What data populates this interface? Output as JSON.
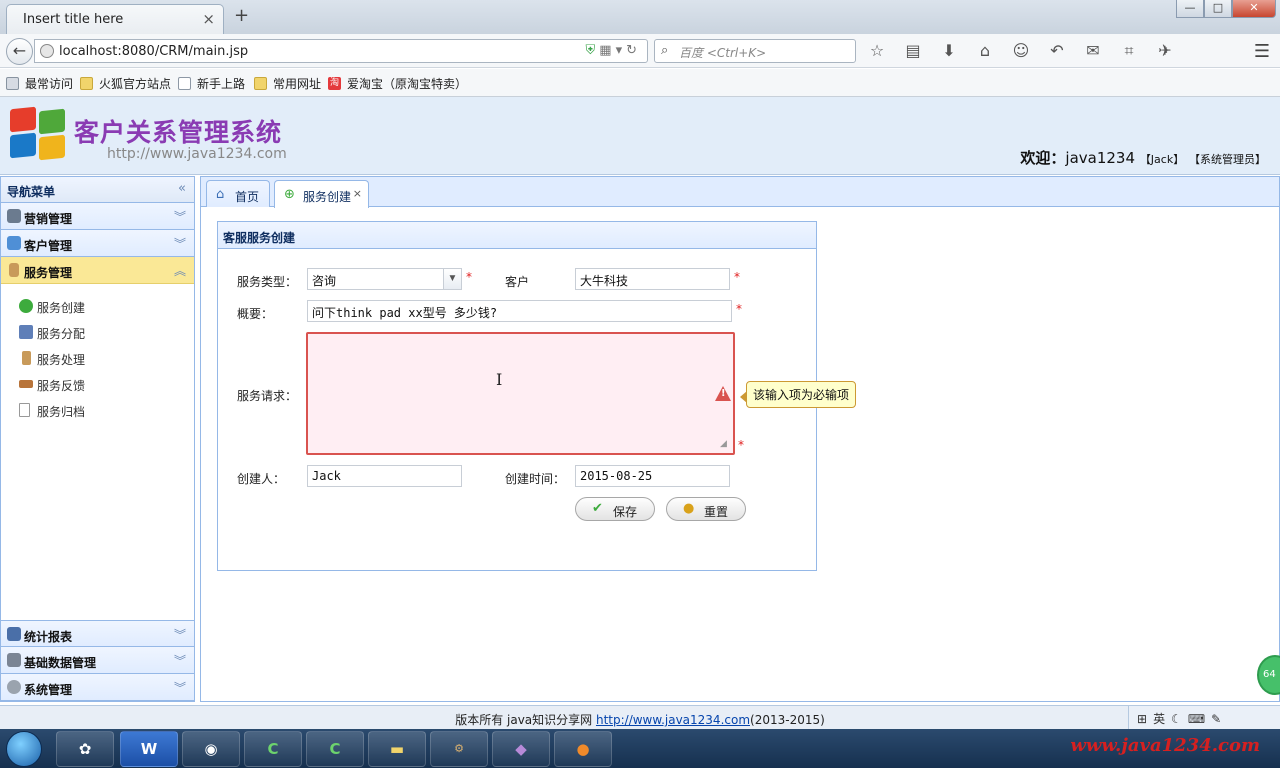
{
  "browser": {
    "tab_title": "Insert title here",
    "tab_close": "×",
    "new_tab": "+",
    "url": "localhost:8080/CRM/main.jsp",
    "search_placeholder": "百度 <Ctrl+K>",
    "window_controls": [
      "—",
      "□",
      "✕"
    ]
  },
  "bookmarks": [
    {
      "label": "最常访问",
      "icon": "star-icon"
    },
    {
      "label": "火狐官方站点",
      "icon": "folder-icon"
    },
    {
      "label": "新手上路",
      "icon": "page-icon"
    },
    {
      "label": "常用网址",
      "icon": "folder-icon"
    },
    {
      "label": "爱淘宝（原淘宝特卖）",
      "icon": "taobao-icon"
    }
  ],
  "header": {
    "title": "客户关系管理系统",
    "url": "http://www.java1234.com",
    "welcome_label": "欢迎：",
    "user": "java1234",
    "name_tag": "【Jack】",
    "role_tag": "【系统管理员】"
  },
  "nav": {
    "title": "导航菜单",
    "sections": [
      {
        "label": "营销管理",
        "expanded": false
      },
      {
        "label": "客户管理",
        "expanded": false
      },
      {
        "label": "服务管理",
        "expanded": true
      },
      {
        "label": "统计报表",
        "expanded": false
      },
      {
        "label": "基础数据管理",
        "expanded": false
      },
      {
        "label": "系统管理",
        "expanded": false
      }
    ],
    "service_items": [
      "服务创建",
      "服务分配",
      "服务处理",
      "服务反馈",
      "服务归档"
    ]
  },
  "tabs": [
    {
      "label": "首页",
      "closable": false
    },
    {
      "label": "服务创建",
      "closable": true
    }
  ],
  "form": {
    "panel_title": "客服服务创建",
    "service_type_label": "服务类型：",
    "service_type_value": "咨询",
    "customer_label": "客户",
    "customer_value": "大牛科技",
    "summary_label": "概要：",
    "summary_value": "问下think pad xx型号 多少钱?",
    "request_label": "服务请求：",
    "request_value": "",
    "creator_label": "创建人：",
    "creator_value": "Jack",
    "created_time_label": "创建时间：",
    "created_time_value": "2015-08-25",
    "required_mark": "*",
    "validation_message": "该输入项为必输项",
    "save_label": "保存",
    "reset_label": "重置"
  },
  "footer": {
    "text": "版本所有 java知识分享网 ",
    "link": "http://www.java1234.com",
    "years": "(2013-2015)",
    "ime": "英"
  },
  "watermark": "www.java1234.com",
  "side_bubble": "64",
  "colors": {
    "accent_border": "#95b8e7",
    "active_section": "#fae896",
    "error": "#d9534f",
    "title_purple": "#8a3bb3"
  }
}
